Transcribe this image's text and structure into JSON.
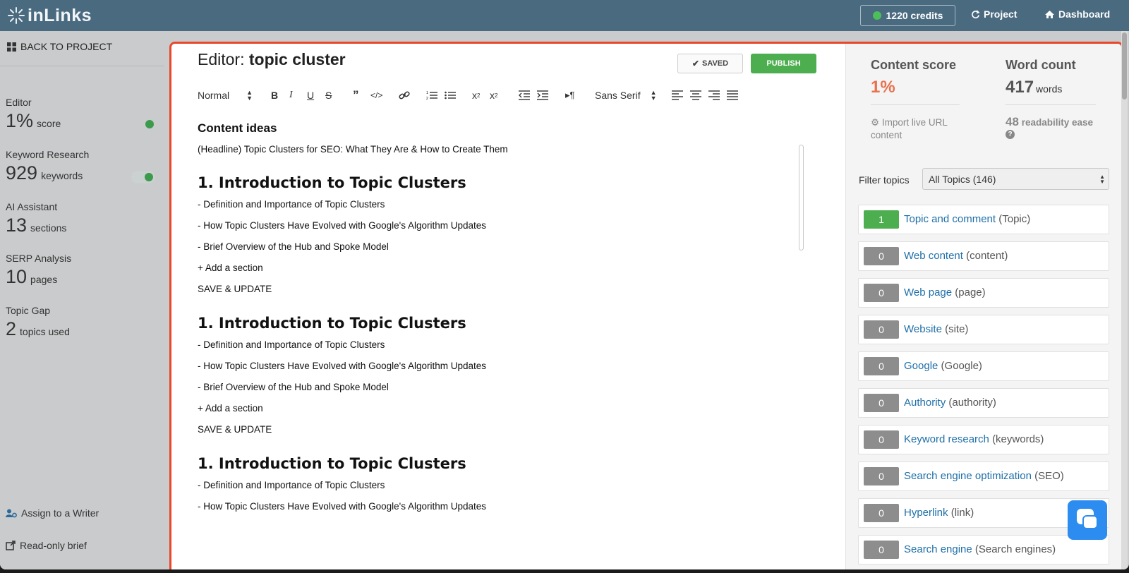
{
  "topbar": {
    "logo": "inLinks",
    "credits": "1220 credits",
    "project": "Project",
    "dashboard": "Dashboard"
  },
  "sidebar": {
    "back": "BACK TO PROJECT",
    "metrics": [
      {
        "title": "Editor",
        "value": "1%",
        "unit": "score"
      },
      {
        "title": "Keyword Research",
        "value": "929",
        "unit": "keywords"
      },
      {
        "title": "AI Assistant",
        "value": "13",
        "unit": "sections"
      },
      {
        "title": "SERP Analysis",
        "value": "10",
        "unit": "pages"
      },
      {
        "title": "Topic Gap",
        "value": "2",
        "unit": "topics used"
      }
    ],
    "assign": "Assign to a Writer",
    "readonly": "Read-only brief"
  },
  "editor": {
    "title_prefix": "Editor:",
    "title_name": "topic cluster",
    "saved": "SAVED",
    "publish": "PUBLISH",
    "toolbar": {
      "format": "Normal",
      "font": "Sans Serif"
    },
    "content_title": "Content ideas",
    "headline": "(Headline) Topic Clusters for SEO: What They Are & How to Create Them",
    "blocks": [
      {
        "heading": "1. Introduction to Topic Clusters",
        "items": [
          "- Definition and Importance of Topic Clusters",
          "- How Topic Clusters Have Evolved with Google's Algorithm Updates",
          "- Brief Overview of the Hub and Spoke Model"
        ],
        "add": "+ Add a section",
        "save": "SAVE & UPDATE"
      },
      {
        "heading": "1. Introduction to Topic Clusters",
        "items": [
          "- Definition and Importance of Topic Clusters",
          "- How Topic Clusters Have Evolved with Google's Algorithm Updates",
          "- Brief Overview of the Hub and Spoke Model"
        ],
        "add": "+ Add a section",
        "save": "SAVE & UPDATE"
      },
      {
        "heading": "1. Introduction to Topic Clusters",
        "items": [
          "- Definition and Importance of Topic Clusters",
          "- How Topic Clusters Have Evolved with Google's Algorithm Updates"
        ]
      }
    ]
  },
  "panel": {
    "content_score_label": "Content score",
    "content_score": "1%",
    "word_count_label": "Word count",
    "word_count": "417",
    "word_unit": "words",
    "import": "Import live URL content",
    "readability_num": "48",
    "readability_text": "readability ease",
    "filter_label": "Filter topics",
    "filter_value": "All Topics (146)",
    "topics": [
      {
        "count": "1",
        "name": "Topic and comment",
        "kw": "(Topic)",
        "active": true
      },
      {
        "count": "0",
        "name": "Web content",
        "kw": "(content)"
      },
      {
        "count": "0",
        "name": "Web page",
        "kw": "(page)"
      },
      {
        "count": "0",
        "name": "Website",
        "kw": "(site)"
      },
      {
        "count": "0",
        "name": "Google",
        "kw": "(Google)"
      },
      {
        "count": "0",
        "name": "Authority",
        "kw": "(authority)"
      },
      {
        "count": "0",
        "name": "Keyword research",
        "kw": "(keywords)"
      },
      {
        "count": "0",
        "name": "Search engine optimization",
        "kw": "(SEO)"
      },
      {
        "count": "0",
        "name": "Hyperlink",
        "kw": "(link)"
      },
      {
        "count": "0",
        "name": "Search engine",
        "kw": "(Search engines)"
      }
    ]
  },
  "colors": {
    "topbar": "#4a6a80",
    "accent_green": "#4cae4f",
    "score_orange": "#e8724f",
    "frame_outline": "#e8472a",
    "link_blue": "#1e6fa8"
  }
}
